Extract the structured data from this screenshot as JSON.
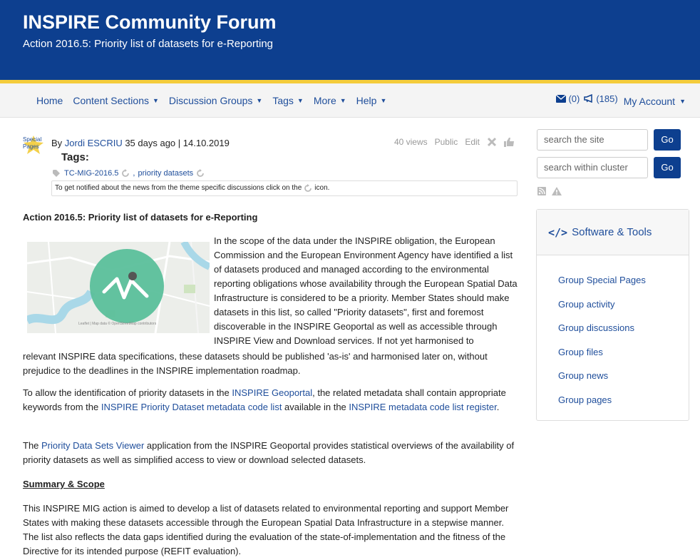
{
  "header": {
    "title": "INSPIRE Community Forum",
    "subtitle": "Action 2016.5: Priority list of datasets for e-Reporting"
  },
  "nav": {
    "items": [
      {
        "label": "Home",
        "dropdown": false
      },
      {
        "label": "Content Sections",
        "dropdown": true
      },
      {
        "label": "Discussion Groups",
        "dropdown": true
      },
      {
        "label": "Tags",
        "dropdown": true
      },
      {
        "label": "More",
        "dropdown": true
      },
      {
        "label": "Help",
        "dropdown": true
      }
    ],
    "messages_count": "(0)",
    "announcements_count": "(185)",
    "account_label": "My Account"
  },
  "post": {
    "special_badge": "Special Pages",
    "byline_prefix": "By ",
    "author": "Jordi ESCRIU",
    "byline_suffix": " 35 days ago | 14.10.2019",
    "views": "40 views",
    "visibility": "Public",
    "edit_label": "Edit",
    "tags_label": "Tags:",
    "tags": [
      "TC-MIG-2016.5",
      "priority datasets"
    ],
    "tag_separator": ",",
    "notify_text_prefix": "To get notified about the news from the theme specific discussions click on the",
    "notify_text_suffix": "icon."
  },
  "article": {
    "section_title": "Action 2016.5: Priority list of datasets for e-Reporting",
    "para1_float": "In the scope of the data under the INSPIRE obligation, the European Commission and the European Environment Agency have identified a list of datasets produced and managed according to the environmental reporting obligations whose availability through the European Spatial Data Infrastructure is considered to be a priority. Member States should make datasets in this list, so called \"Priority datasets\", first and foremost discoverable in the INSPIRE Geoportal as well as accessible through INSPIRE View and Download services. If not yet harmonised to",
    "para1_continue": "relevant INSPIRE data specifications, these datasets should be published 'as-is' and harmonised later on, without prejudice to the deadlines in the INSPIRE implementation roadmap.",
    "para2_a": "To allow the identification of priority datasets in the ",
    "para2_link1": "INSPIRE Geoportal",
    "para2_b": ", the related metadata shall contain appropriate keywords from the ",
    "para2_link2": "INSPIRE Priority Dataset metadata code list",
    "para2_c": " available in the ",
    "para2_link3": "INSPIRE metadata code list register",
    "para2_d": ".",
    "para3_a": "The ",
    "para3_link": "Priority Data Sets Viewer",
    "para3_b": " application from the INSPIRE Geoportal provides statistical overviews of the availability of priority datasets as well as simplified access to view or download selected datasets.",
    "summary_heading": "Summary & Scope",
    "para4": "This INSPIRE MIG action is aimed to develop a list of datasets related to environmental reporting and support Member States with making these datasets accessible through the European Spatial Data Infrastructure in a stepwise manner. The list also reflects the data gaps identified during the evaluation of the state-of-implementation and the fitness of the Directive for its intended purpose (REFIT evaluation).",
    "map_credit": "Leaflet | Map data © OpenStreetMap contributors"
  },
  "sidebar": {
    "search_site_placeholder": "search the site",
    "search_cluster_placeholder": "search within cluster",
    "go_label": "Go",
    "tools_title": "Software & Tools",
    "tools_icon": "code-icon",
    "tools_items": [
      "Group Special Pages",
      "Group activity",
      "Group discussions",
      "Group files",
      "Group news",
      "Group pages"
    ]
  },
  "colors": {
    "header_blue": "#0d3f8f",
    "stripe_yellow": "#f4cc3c",
    "link_blue": "#1f4e9b",
    "map_teal": "#5bbf9b"
  }
}
